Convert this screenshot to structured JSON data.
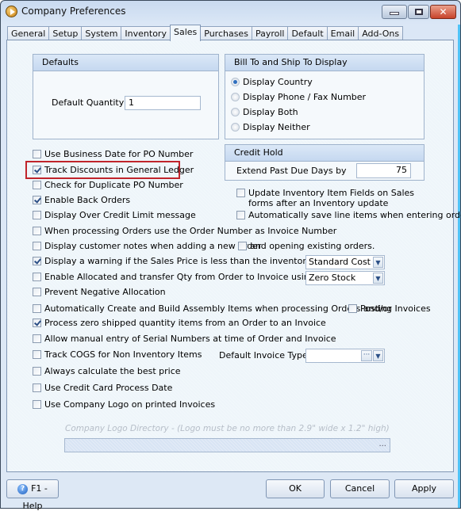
{
  "window": {
    "title": "Company Preferences"
  },
  "tabs": [
    "General",
    "Setup",
    "System",
    "Inventory",
    "Sales",
    "Purchases",
    "Payroll",
    "Default",
    "Email",
    "Add-Ons"
  ],
  "active_tab": "Sales",
  "defaults": {
    "header": "Defaults",
    "quantity_label": "Default Quantity",
    "quantity_value": "1"
  },
  "bill_ship": {
    "header": "Bill To and Ship To Display",
    "options": [
      {
        "label": "Display Country",
        "selected": true
      },
      {
        "label": "Display Phone / Fax Number",
        "selected": false
      },
      {
        "label": "Display Both",
        "selected": false
      },
      {
        "label": "Display Neither",
        "selected": false
      }
    ]
  },
  "credit_hold": {
    "header": "Credit Hold",
    "label": "Extend Past Due Days by",
    "value": "75"
  },
  "right_checks": [
    {
      "label": "Update Inventory Item Fields on Sales",
      "label2": "forms after an Inventory update",
      "checked": false
    },
    {
      "label": "Automatically save line items when entering orders",
      "checked": false
    }
  ],
  "checks": [
    {
      "label": "Use Business Date for PO Number",
      "checked": false
    },
    {
      "label": "Track Discounts in General Ledger",
      "checked": true
    },
    {
      "label": "Check for Duplicate PO Number",
      "checked": false
    },
    {
      "label": "Enable Back Orders",
      "checked": true
    },
    {
      "label": "Display Over Credit Limit message",
      "checked": false
    },
    {
      "label": "When processing Orders use the Order Number as Invoice Number",
      "checked": false
    },
    {
      "label": "Display customer notes when adding a new order",
      "checked": false
    },
    {
      "label": "Display a warning if the Sales Price is less than the inventory items",
      "checked": true
    },
    {
      "label": "Enable Allocated and transfer Qty from Order to Invoice using :",
      "checked": false
    },
    {
      "label": "Prevent Negative Allocation",
      "checked": false
    },
    {
      "label": "Automatically Create and Build Assembly Items when processing Orders and/or",
      "checked": false
    },
    {
      "label": "Process zero shipped quantity items from an Order to an Invoice",
      "checked": true
    },
    {
      "label": "Allow manual entry of Serial Numbers at time of Order and Invoice",
      "checked": false
    },
    {
      "label": "Track COGS for Non Inventory Items",
      "checked": false
    },
    {
      "label": "Always calculate the best price",
      "checked": false
    },
    {
      "label": "Use Credit Card Process Date",
      "checked": false
    },
    {
      "label": "Use Company Logo on printed Invoices",
      "checked": false
    }
  ],
  "opening_existing": {
    "label": "and opening existing orders.",
    "checked": false
  },
  "posting_invoices": {
    "label": "Posting Invoices",
    "checked": false
  },
  "sales_price_select": "Standard Cost",
  "allocated_select": "Zero Stock",
  "default_invoice_type": {
    "label": "Default Invoice Type",
    "value": ""
  },
  "logo": {
    "label": "Company Logo Directory - (Logo must be no more than 2.9\" wide x 1.2\" high)",
    "value": "",
    "browse": "..."
  },
  "buttons": {
    "help": "F1 - Help",
    "ok": "OK",
    "cancel": "Cancel",
    "apply": "Apply"
  }
}
